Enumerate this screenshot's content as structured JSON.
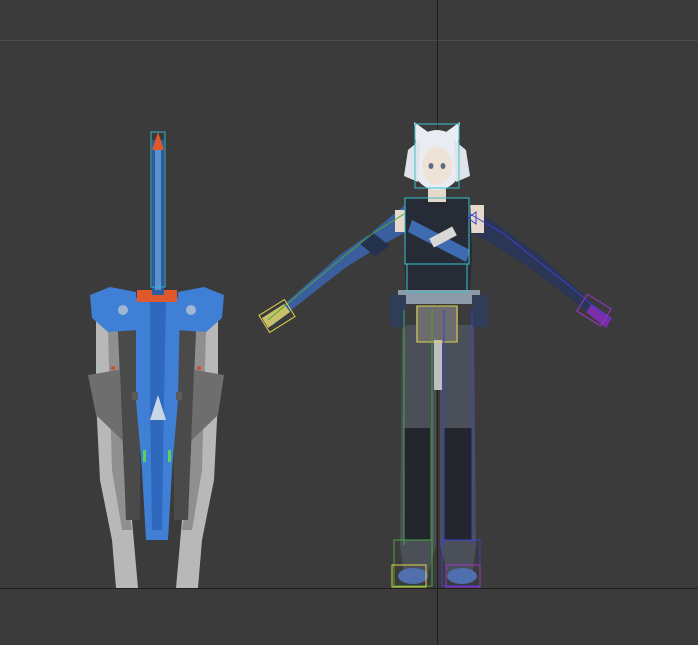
{
  "viewport": {
    "background_color": "#3b3b3b",
    "grid_line_color": "#4d4d4d",
    "axis_line_color": "#1f1f1f"
  },
  "scene": {
    "objects": [
      {
        "id": "mech-weapon",
        "icon": "mech-weapon-model"
      },
      {
        "id": "cat-eared-character",
        "icon": "character-model"
      }
    ]
  },
  "palette": {
    "blue": "#3f7fd6",
    "dark_blue": "#245ba8",
    "orange": "#e0582b",
    "gray": "#9a9a9a",
    "dark_gray": "#626262",
    "light_gray": "#c4c4c4",
    "skin": "#efe3d8",
    "hair": "#e9ecf2",
    "suit": "#2a2f3a",
    "bone_cyan": "#39c3cf",
    "bone_green": "#4aa63c",
    "bone_blue": "#3f3fcf",
    "bone_yellow": "#e0d34a",
    "bone_purple": "#9b35c8"
  }
}
